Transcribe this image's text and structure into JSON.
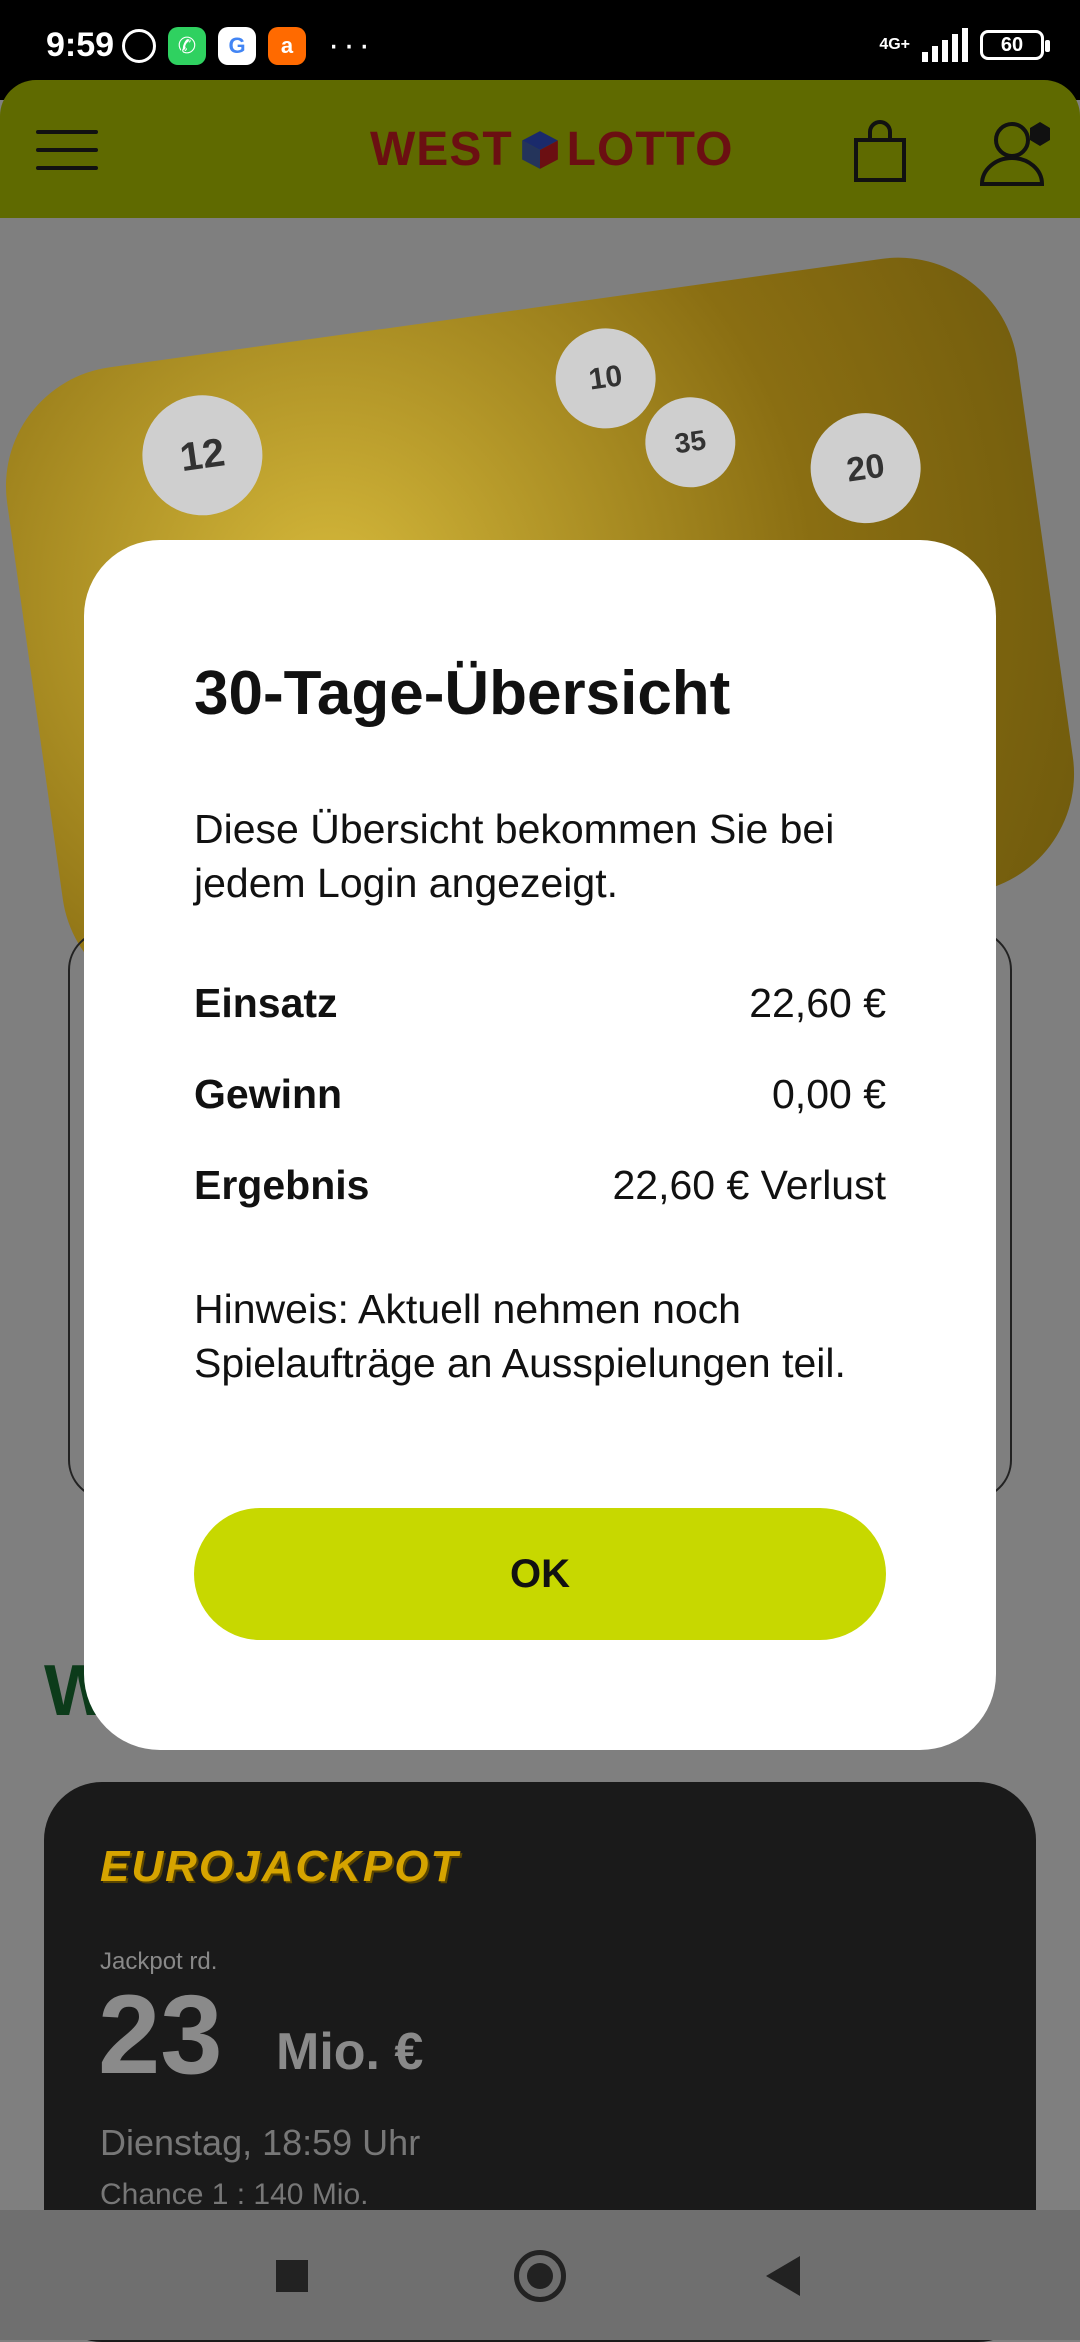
{
  "statusbar": {
    "time": "9:59",
    "network": "4G+",
    "battery": "60",
    "icons": [
      "alarm-icon",
      "whatsapp-icon",
      "google-icon",
      "alibaba-icon"
    ],
    "more": "···"
  },
  "header": {
    "logo_left": "WEST",
    "logo_right": "LOTTO",
    "colors": {
      "bar": "#5f6a00",
      "logo": "#6b0f12"
    }
  },
  "background": {
    "section_letter": "W",
    "balls": [
      "12",
      "12",
      "10",
      "35",
      "20"
    ],
    "eurojackpot": {
      "logo": "EUROJACKPOT",
      "label": "Jackpot rd.",
      "amount": "23",
      "unit": "Mio. €",
      "date": "Dienstag, 18:59 Uhr",
      "chance": "Chance 1 : 140 Mio."
    }
  },
  "modal": {
    "title": "30-Tage-Übersicht",
    "description": "Diese Übersicht bekommen Sie bei jedem Login angezeigt.",
    "rows": [
      {
        "label": "Einsatz",
        "value": "22,60 €"
      },
      {
        "label": "Gewinn",
        "value": "0,00 €"
      },
      {
        "label": "Ergebnis",
        "value": "22,60 € Verlust"
      }
    ],
    "note": "Hinweis: Aktuell nehmen noch Spielaufträge an Ausspielungen teil.",
    "ok_label": "OK",
    "accent": "#c7d800"
  }
}
